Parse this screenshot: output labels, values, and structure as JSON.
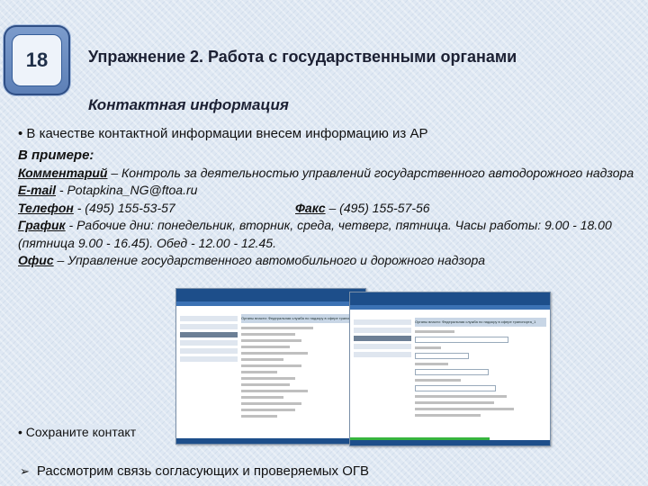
{
  "slide": {
    "number": "18",
    "title": "Упражнение 2. Работа с государственными органами",
    "subtitle": "Контактная информация",
    "bullet_intro": "• В качестве контактной информации внесем информацию из АР",
    "example_label": "В примере:",
    "comment_label": "Комментарий",
    "comment_text": " – Контроль за деятельностью управлений государственного автодорожного надзора",
    "email_label": "E-mail",
    "email_text": " - Potapkina_NG@ftoa.ru",
    "phone_label": "Телефон",
    "phone_text": " - (495) 155-53-57",
    "fax_label": "Факс",
    "fax_text": " – (495) 155-57-56",
    "schedule_label": "График",
    "schedule_text": " - Рабочие дни: понедельник, вторник, среда, четверг, пятница. Часы работы: 9.00 - 18.00 (пятница 9.00 - 16.45). Обед - 12.00 - 12.45.",
    "office_label": "Офис",
    "office_text": " – Управление государственного автомобильного и дорожного надзора",
    "bullet_save": "• Сохраните контакт",
    "bottom_text": "Рассмотрим связь согласующих и проверяемых ОГВ",
    "bottom_icon": "arrow-bullet-icon"
  },
  "screenshot_left": {
    "window_title": "Органы власти: Федеральная служба по надзору в сфере транспорта"
  },
  "screenshot_right": {
    "window_title": "Органы власти: Федеральная служба по надзору в сфере транспорта_1"
  },
  "colors": {
    "header_blue": "#1d4e8a",
    "number_box": "#5c7fb6",
    "progress_green": "#37b53f"
  }
}
